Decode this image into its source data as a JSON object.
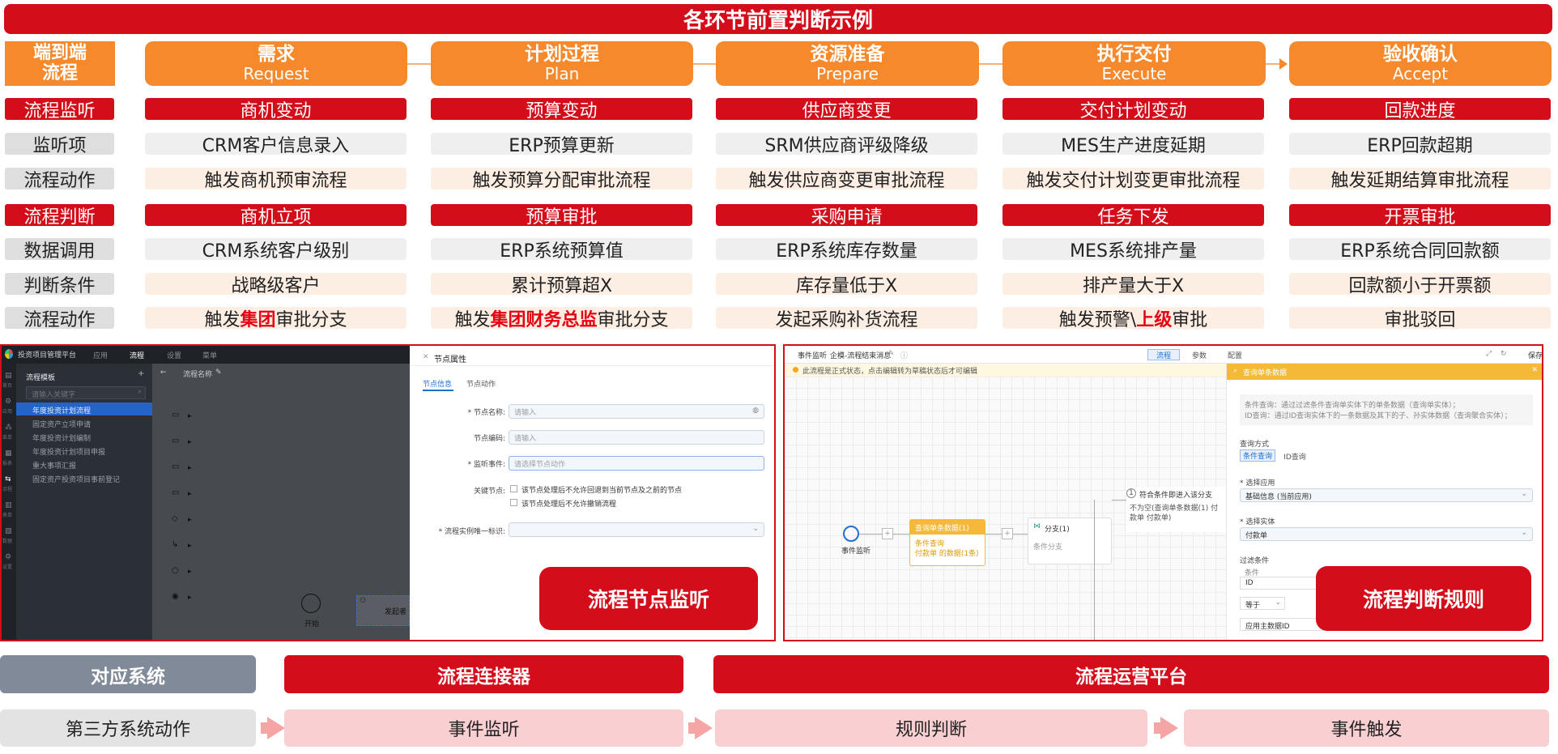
{
  "title": "各环节前置判断示例",
  "stages": {
    "corner": "端到端\n流程",
    "items": [
      {
        "cn": "需求",
        "en": "Request"
      },
      {
        "cn": "计划过程",
        "en": "Plan"
      },
      {
        "cn": "资源准备",
        "en": "Prepare"
      },
      {
        "cn": "执行交付",
        "en": "Execute"
      },
      {
        "cn": "验收确认",
        "en": "Accept"
      }
    ]
  },
  "rows": [
    {
      "label": "流程监听",
      "style": "red",
      "cells": [
        "商机变动",
        "预算变动",
        "供应商变更",
        "交付计划变动",
        "回款进度"
      ]
    },
    {
      "label": "监听项",
      "style": "gray",
      "cells": [
        "CRM客户信息录入",
        "ERP预算更新",
        "SRM供应商评级降级",
        "MES生产进度延期",
        "ERP回款超期"
      ]
    },
    {
      "label": "流程动作",
      "style": "peach",
      "cells": [
        "触发商机预审流程",
        "触发预算分配审批流程",
        "触发供应商变更审批流程",
        "触发交付计划变更审批流程",
        "触发延期结算审批流程"
      ]
    },
    {
      "label": "流程判断",
      "style": "red",
      "cells": [
        "商机立项",
        "预算审批",
        "采购申请",
        "任务下发",
        "开票审批"
      ]
    },
    {
      "label": "数据调用",
      "style": "gray",
      "cells": [
        "CRM系统客户级别",
        "ERP系统预算值",
        "ERP系统库存数量",
        "MES系统排产量",
        "ERP系统合同回款额"
      ]
    },
    {
      "label": "判断条件",
      "style": "peach",
      "cells": [
        "战略级客户",
        "累计预算超X",
        "库存量低于X",
        "排产量大于X",
        "回款额小于开票额"
      ]
    }
  ],
  "last_row": {
    "label": "流程动作",
    "cells": [
      {
        "pre": "触发",
        "hl": "集团",
        "post": "审批分支"
      },
      {
        "pre": "触发",
        "hl": "集团财务总监",
        "post": "审批分支"
      },
      {
        "pre": "发起采购补货流程",
        "hl": "",
        "post": ""
      },
      {
        "pre": "触发预警\\",
        "hl": "上级",
        "post": "审批"
      },
      {
        "pre": "审批驳回",
        "hl": "",
        "post": ""
      }
    ]
  },
  "left_shot": {
    "app_title": "投资项目管理平台",
    "top_tabs": [
      "应用",
      "流程",
      "设置",
      "菜单"
    ],
    "side_icons": [
      "首页",
      "应用",
      "菜单",
      "报表",
      "流程",
      "表单",
      "数据",
      "设置"
    ],
    "panel_title": "流程模板",
    "search_placeholder": "请输入关键字",
    "tree_items": [
      "年度投资计划流程",
      "固定资产立项申请",
      "年度投资计划编制",
      "年度投资计划项目申报",
      "重大事项汇报",
      "固定资产投资项目事前登记"
    ],
    "flow_name": "流程名称",
    "start_label": "开始",
    "node_label": "发起者",
    "props_title": "节点属性",
    "props_tabs": [
      "节点信息",
      "节点动作"
    ],
    "fields": [
      {
        "label": "* 节点名称:",
        "placeholder": "请输入"
      },
      {
        "label": "节点编码:",
        "placeholder": "请输入"
      },
      {
        "label": "* 监听事件:",
        "placeholder": "请选择节点动作"
      }
    ],
    "key_node_label": "关键节点:",
    "key_node_opts": [
      "该节点处理后不允许回退到当前节点及之前的节点",
      "该节点处理后不允许撤销流程"
    ],
    "instance_label": "* 流程实例唯一标识:",
    "badge": "流程节点监听"
  },
  "right_shot": {
    "top_tabs": [
      "事件监听",
      "企模-流程结束消息"
    ],
    "mode_tabs": [
      "流程",
      "参数",
      "配置"
    ],
    "top_right": "保存",
    "notice": "此流程是正式状态，点击编辑转为草稿状态后才可编辑",
    "event_node": "事件监听",
    "query_node": "查询单条数据(1)",
    "query_sub": [
      "条件查询",
      "付款单 的数据(1条)"
    ],
    "branch_node": "分支(1)",
    "branch_sub": "条件分支",
    "cond_title": "符合条件即进入该分支",
    "cond_text": "不为空(查询单条数据(1) 付款单 付款单)",
    "panel_title": "查询单条数据",
    "desc": [
      "条件查询：通过过滤条件查询单实体下的单条数据（查询单实体）；",
      "ID查询：通过ID查询实体下的一条数据及其下的子、孙实体数据（查询聚合实体）；"
    ],
    "query_mode_label": "查询方式",
    "query_modes": [
      "条件查询",
      "ID查询"
    ],
    "app_label": "* 选择应用",
    "app_value": "基础信息 (当前应用)",
    "entity_label": "* 选择实体",
    "entity_value": "付款单",
    "filter_label": "过滤条件",
    "cond_col": "条件",
    "filter_field": "ID",
    "filter_op": "等于",
    "filter_value": "应用主数据ID",
    "badge": "流程判断规则"
  },
  "bottom": {
    "headers": [
      "对应系统",
      "流程连接器",
      "流程运营平台"
    ],
    "cells": [
      "第三方系统动作",
      "事件监听",
      "规则判断",
      "事件触发"
    ]
  }
}
